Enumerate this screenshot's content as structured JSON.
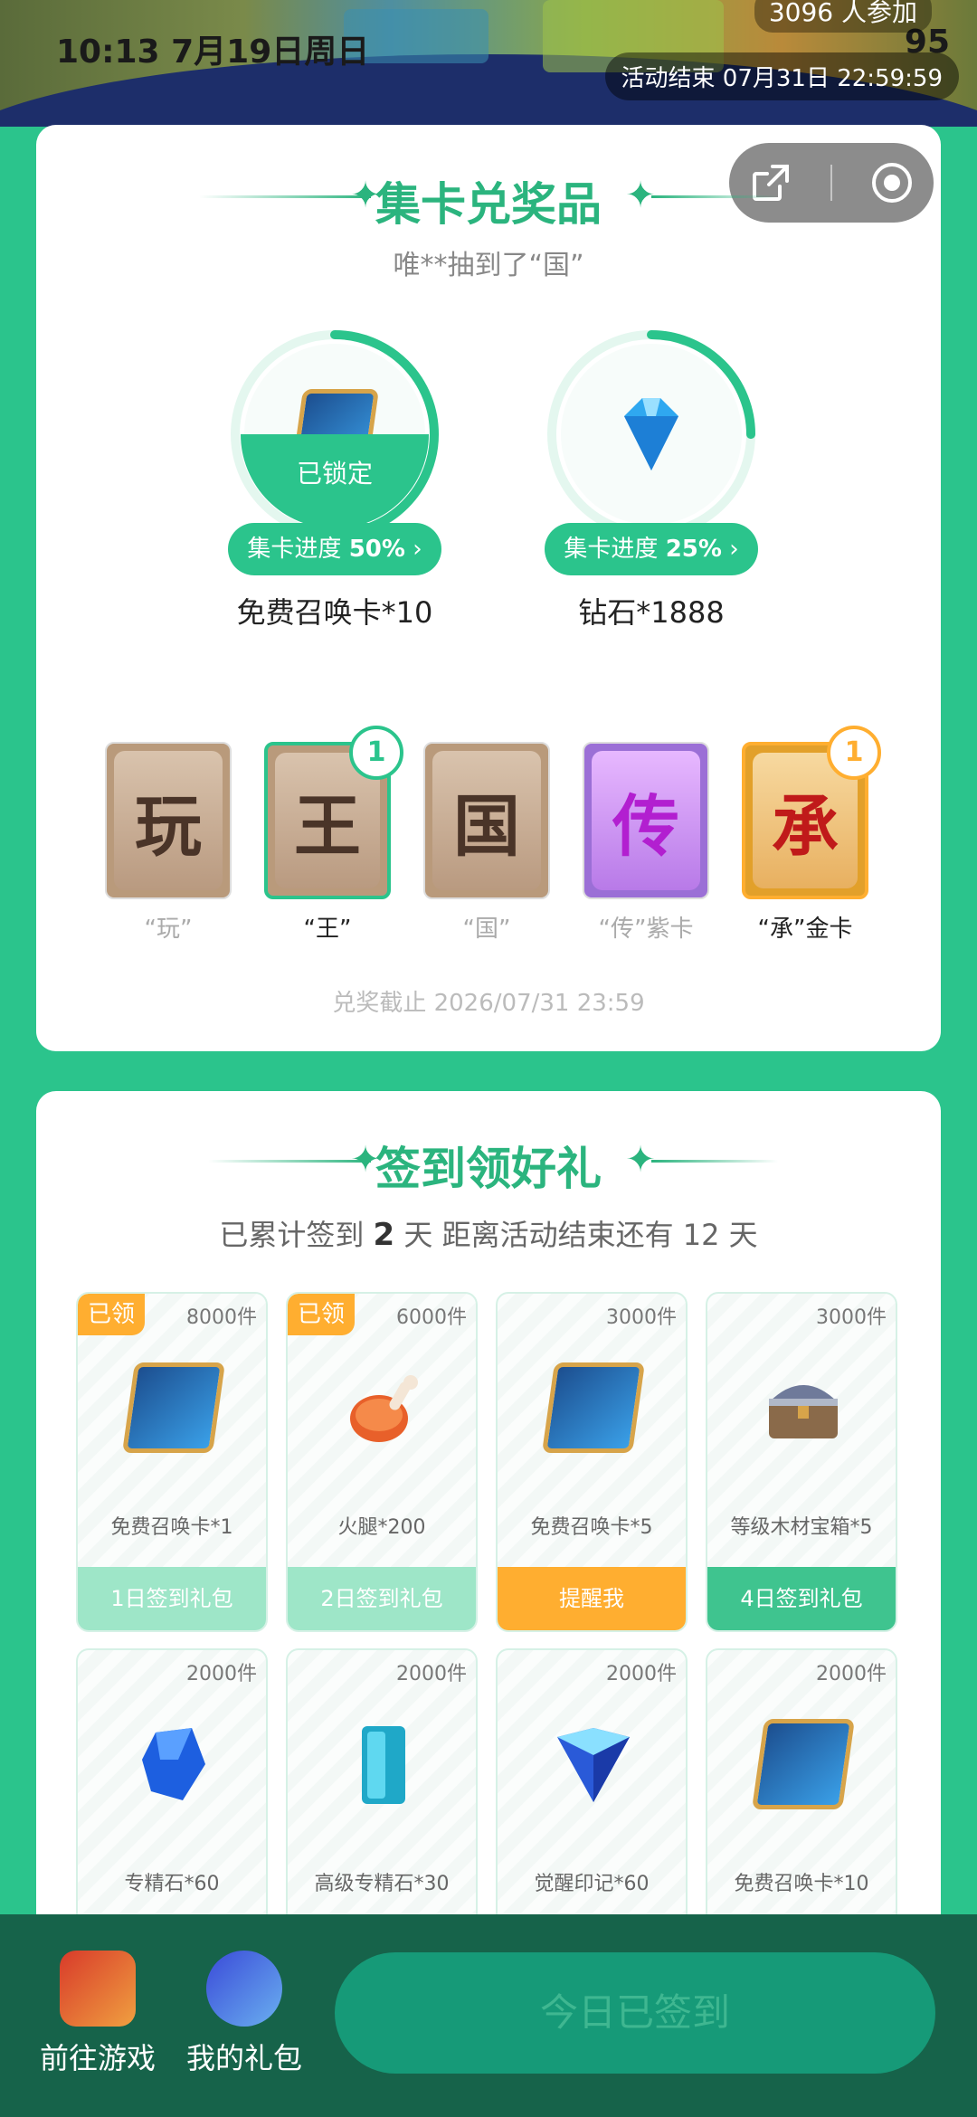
{
  "status_bar": {
    "time": "10:13 7月19日周日",
    "battery": "95"
  },
  "header": {
    "participants": "3096 人参加",
    "activity_end": "活动结束 07月31日 22:59:59"
  },
  "section1": {
    "title": "集卡兑奖品",
    "subtitle": "唯**抽到了“国”",
    "prizes": [
      {
        "name": "免费召唤卡*10",
        "progress_label": "集卡进度",
        "progress_value": "50%",
        "progress_fraction": 0.5,
        "locked_label": "已锁定"
      },
      {
        "name": "钻石*1888",
        "progress_label": "集卡进度",
        "progress_value": "25%",
        "progress_fraction": 0.25
      }
    ],
    "word_cards": [
      {
        "char": "玩",
        "caption": "“玩”",
        "owned": false
      },
      {
        "char": "王",
        "caption": "“王”",
        "owned": true,
        "count": "1"
      },
      {
        "char": "国",
        "caption": "“国”",
        "owned": false
      },
      {
        "char": "传",
        "caption": "“传”紫卡",
        "owned": false
      },
      {
        "char": "承",
        "caption": "“承”金卡",
        "owned": true,
        "count": "1"
      }
    ],
    "deadline": "兑奖截止 2026/07/31 23:59"
  },
  "section2": {
    "title": "签到领好礼",
    "stats_prefix": "已累计签到",
    "signed_days": "2",
    "stats_suffix": "天  距离活动结束还有 12 天",
    "gifts": [
      {
        "count": "8000件",
        "name": "免费召唤卡*1",
        "action": "1日签到礼包",
        "claimed": "已领",
        "state": "claimed",
        "icon": "summon-card-icon"
      },
      {
        "count": "6000件",
        "name": "火腿*200",
        "action": "2日签到礼包",
        "claimed": "已领",
        "state": "claimed",
        "icon": "ham-icon"
      },
      {
        "count": "3000件",
        "name": "免费召唤卡*5",
        "action": "提醒我",
        "state": "remind",
        "icon": "summon-card-icon"
      },
      {
        "count": "3000件",
        "name": "等级木材宝箱*5",
        "action": "4日签到礼包",
        "state": "pending",
        "icon": "treasure-chest-icon"
      },
      {
        "count": "2000件",
        "name": "专精石*60",
        "state": "pending",
        "icon": "blue-gem-icon"
      },
      {
        "count": "2000件",
        "name": "高级专精石*30",
        "state": "pending",
        "icon": "crystal-block-icon"
      },
      {
        "count": "2000件",
        "name": "觉醒印记*60",
        "state": "pending",
        "icon": "awaken-mark-icon"
      },
      {
        "count": "2000件",
        "name": "免费召唤卡*10",
        "state": "pending",
        "icon": "summon-card-icon"
      }
    ]
  },
  "bottom_bar": {
    "go_game": "前往游戏",
    "my_gifts": "我的礼包",
    "signed_today": "今日已签到"
  },
  "colors": {
    "accent": "#2bc48c",
    "dark_green": "#16634a",
    "orange": "#ffae30",
    "claimed_action": "#9ee6c8",
    "pending_action": "#3fc48f"
  }
}
